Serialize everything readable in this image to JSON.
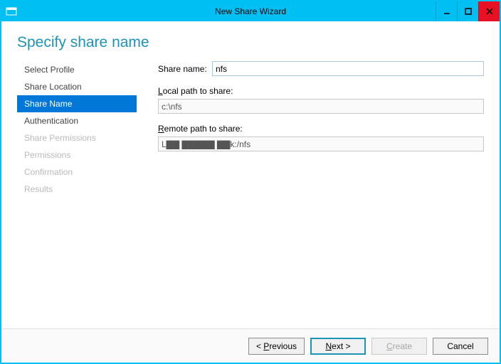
{
  "window": {
    "title": "New Share Wizard"
  },
  "heading": "Specify share name",
  "sidebar": {
    "items": [
      {
        "label": "Select Profile",
        "state": "normal"
      },
      {
        "label": "Share Location",
        "state": "normal"
      },
      {
        "label": "Share Name",
        "state": "active"
      },
      {
        "label": "Authentication",
        "state": "normal"
      },
      {
        "label": "Share Permissions",
        "state": "disabled"
      },
      {
        "label": "Permissions",
        "state": "disabled"
      },
      {
        "label": "Confirmation",
        "state": "disabled"
      },
      {
        "label": "Results",
        "state": "disabled"
      }
    ]
  },
  "form": {
    "share_name_label": "Share name:",
    "share_name_value": "nfs",
    "local_path_label_pre": "L",
    "local_path_label_rest": "ocal path to share:",
    "local_path_value": "c:\\nfs",
    "remote_path_label_pre": "R",
    "remote_path_label_rest": "emote path to share:",
    "remote_path_value": "L▇▇ ▇▇▇▇▇ ▇▇k:/nfs"
  },
  "footer": {
    "previous_pre": "< ",
    "previous_u": "P",
    "previous_rest": "revious",
    "next_u": "N",
    "next_rest": "ext >",
    "create_u": "C",
    "create_rest": "reate",
    "cancel": "Cancel"
  }
}
